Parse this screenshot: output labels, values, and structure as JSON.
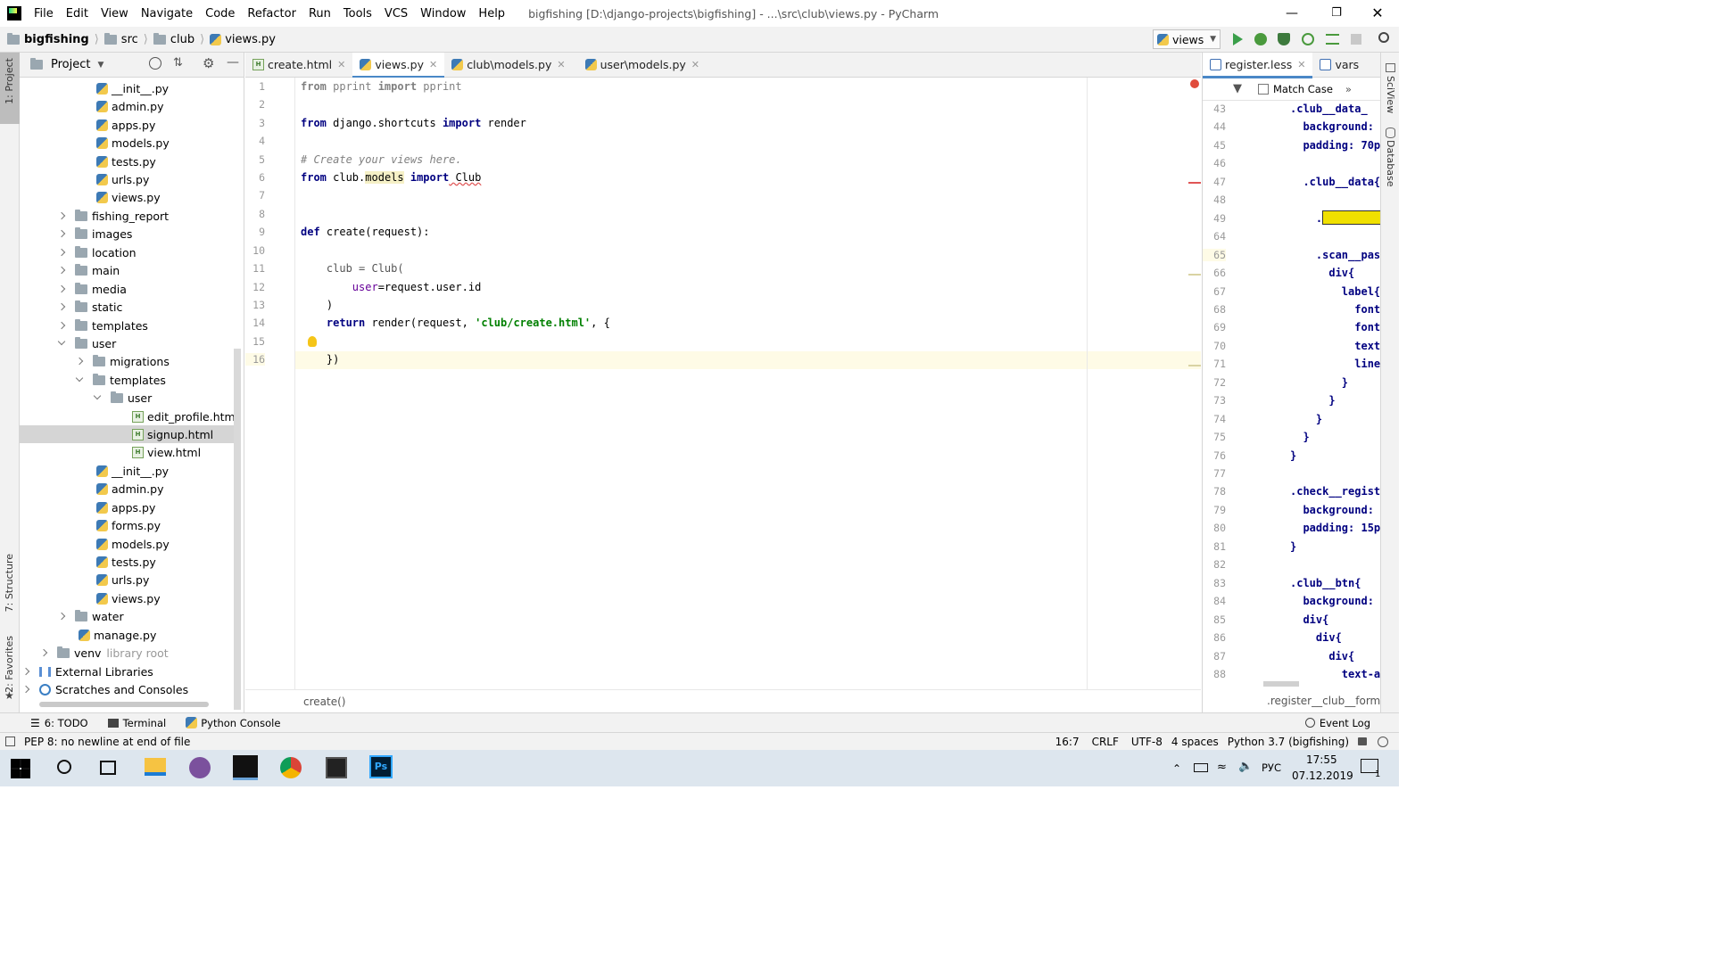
{
  "window": {
    "title": "bigfishing [D:\\django-projects\\bigfishing] - ...\\src\\club\\views.py - PyCharm",
    "menu": [
      "File",
      "Edit",
      "View",
      "Navigate",
      "Code",
      "Refactor",
      "Run",
      "Tools",
      "VCS",
      "Window",
      "Help"
    ]
  },
  "navbar": {
    "crumbs": [
      "bigfishing",
      "src",
      "club",
      "views.py"
    ],
    "run_config": "views"
  },
  "left_tool": {
    "project": "1: Project",
    "structure": "7: Structure",
    "favorites": "2: Favorites"
  },
  "project": {
    "title": "Project",
    "items": [
      {
        "label": "__init__.py"
      },
      {
        "label": "admin.py"
      },
      {
        "label": "apps.py"
      },
      {
        "label": "models.py"
      },
      {
        "label": "tests.py"
      },
      {
        "label": "urls.py"
      },
      {
        "label": "views.py"
      },
      {
        "label": "fishing_report"
      },
      {
        "label": "images"
      },
      {
        "label": "location"
      },
      {
        "label": "main"
      },
      {
        "label": "media"
      },
      {
        "label": "static"
      },
      {
        "label": "templates"
      },
      {
        "label": "user"
      },
      {
        "label": "migrations"
      },
      {
        "label": "templates"
      },
      {
        "label": "user"
      },
      {
        "label": "edit_profile.html"
      },
      {
        "label": "signup.html"
      },
      {
        "label": "view.html"
      },
      {
        "label": "__init__.py"
      },
      {
        "label": "admin.py"
      },
      {
        "label": "apps.py"
      },
      {
        "label": "forms.py"
      },
      {
        "label": "models.py"
      },
      {
        "label": "tests.py"
      },
      {
        "label": "urls.py"
      },
      {
        "label": "views.py"
      },
      {
        "label": "water"
      },
      {
        "label": "manage.py"
      },
      {
        "label": "venv"
      },
      {
        "label": "External Libraries"
      },
      {
        "label": "Scratches and Consoles"
      }
    ],
    "venv_suffix": "library root"
  },
  "editor_tabs": [
    "create.html",
    "views.py",
    "club\\models.py",
    "user\\models.py"
  ],
  "code_lines": [
    {
      "n": "1"
    },
    {
      "n": "2"
    },
    {
      "n": "3"
    },
    {
      "n": "4"
    },
    {
      "n": "5"
    },
    {
      "n": "6"
    },
    {
      "n": "7"
    },
    {
      "n": "8"
    },
    {
      "n": "9"
    },
    {
      "n": "10"
    },
    {
      "n": "11"
    },
    {
      "n": "12"
    },
    {
      "n": "13"
    },
    {
      "n": "14"
    },
    {
      "n": "15"
    },
    {
      "n": "16"
    }
  ],
  "code": {
    "l1a": "from",
    "l1b": " pprint ",
    "l1c": "import",
    "l1d": " pprint",
    "l3a": "from",
    "l3b": " django.shortcuts ",
    "l3c": "import",
    "l3d": " render",
    "l5": "# Create your views here.",
    "l6a": "from",
    "l6b": " club.",
    "l6c": "models",
    "l6d": " ",
    "l6e": "import",
    "l6f": " Club",
    "l9a": "def",
    "l9b": " create(request):",
    "l11a": "    club = Club(",
    "l12a": "        ",
    "l12b": "user",
    "l12c": "=request.user.id",
    "l13": "    )",
    "l14a": "    ",
    "l14b": "return",
    "l14c": " render(request, ",
    "l14d": "'club/create.html'",
    "l14e": ", {",
    "l16": "    })"
  },
  "editor_breadcrumb": "create()",
  "right_panel": {
    "tabs": [
      "register.less",
      "vars"
    ],
    "match_case": "Match Case",
    "breadcrumb": ".register__club__form",
    "lines": [
      "43",
      "44",
      "45",
      "46",
      "47",
      "48",
      "49",
      "64",
      "65",
      "66",
      "67",
      "68",
      "69",
      "70",
      "71",
      "72",
      "73",
      "74",
      "75",
      "76",
      "77",
      "78",
      "79",
      "80",
      "81",
      "82",
      "83",
      "84",
      "85",
      "86",
      "87",
      "88"
    ],
    "code": [
      ".club__data_",
      "  background:",
      "  padding: 70p",
      "",
      "  .club__data{",
      "",
      "    .club__dat",
      "",
      "    .scan__pas",
      "      div{",
      "        label{",
      "          font",
      "          font",
      "          text",
      "          line",
      "        }",
      "      }",
      "    }",
      "  }",
      "}",
      "",
      ".check__regist",
      "  background:",
      "  padding: 15p",
      "}",
      "",
      ".club__btn{",
      "  background:",
      "  div{",
      "    div{",
      "      div{",
      "        text-a"
    ]
  },
  "right_tool": {
    "sciview": "SciView",
    "database": "Database"
  },
  "bottom_tools": {
    "todo": "6: TODO",
    "terminal": "Terminal",
    "python_console": "Python Console",
    "event_log": "Event Log"
  },
  "status": {
    "message": "PEP 8: no newline at end of file",
    "position": "16:7",
    "line_sep": "CRLF",
    "encoding": "UTF-8",
    "indent": "4 spaces",
    "interpreter": "Python 3.7 (bigfishing)"
  },
  "taskbar": {
    "time": "17:55",
    "date": "07.12.2019",
    "lang": "РУС",
    "notif_count": "1"
  }
}
